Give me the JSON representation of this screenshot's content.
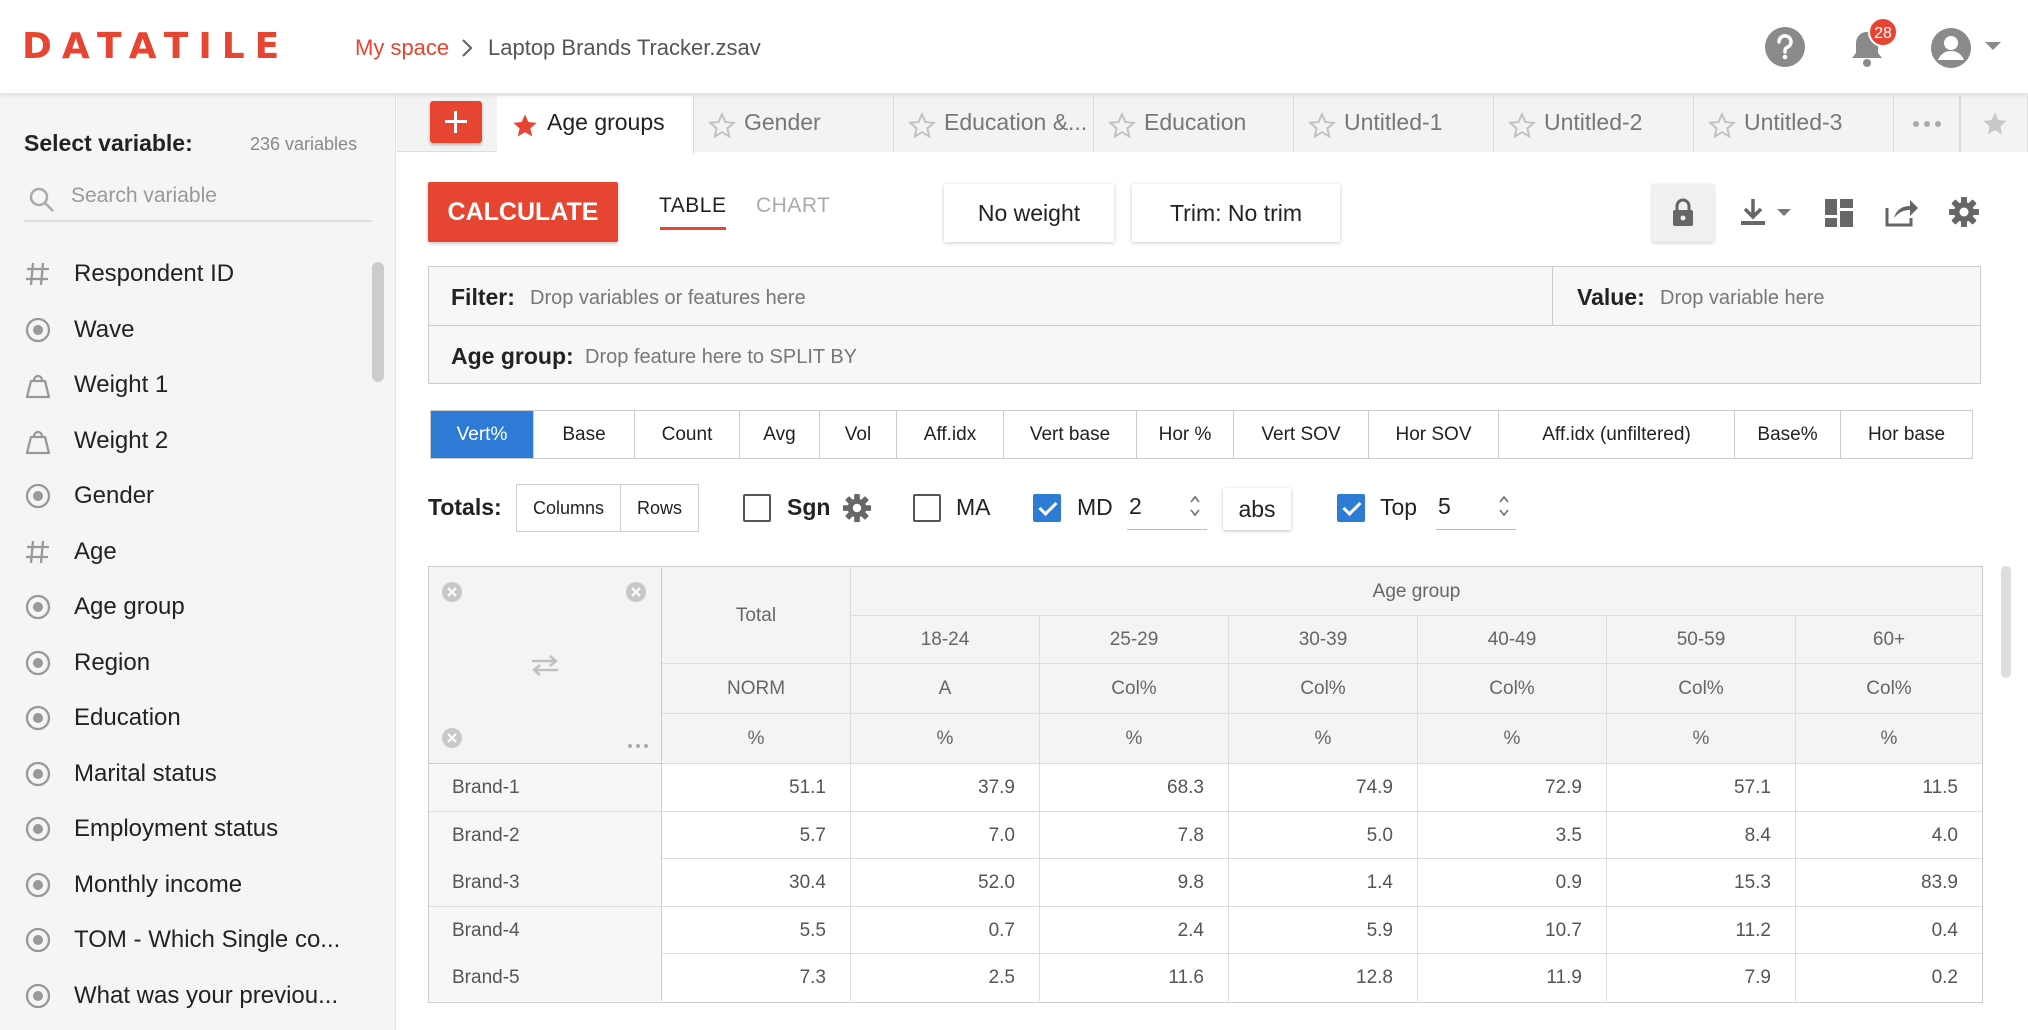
{
  "brand": {
    "logo": "DATATILE",
    "accent": "#e64532"
  },
  "header": {
    "breadcrumb_link": "My space",
    "breadcrumb_file": "Laptop Brands Tracker.zsav",
    "notification_count": "28",
    "icons": [
      "help-icon",
      "bell-icon",
      "user-icon",
      "chevron-down-icon"
    ]
  },
  "sidebar": {
    "title": "Select variable:",
    "count": "236 variables",
    "search_placeholder": "Search variable",
    "items": [
      {
        "label": "Respondent ID",
        "icon": "hash-icon"
      },
      {
        "label": "Wave",
        "icon": "radio-icon"
      },
      {
        "label": "Weight 1",
        "icon": "weight-icon"
      },
      {
        "label": "Weight 2",
        "icon": "weight-icon"
      },
      {
        "label": "Gender",
        "icon": "radio-icon"
      },
      {
        "label": "Age",
        "icon": "hash-icon"
      },
      {
        "label": "Age group",
        "icon": "radio-icon"
      },
      {
        "label": "Region",
        "icon": "radio-icon"
      },
      {
        "label": "Education",
        "icon": "radio-icon"
      },
      {
        "label": "Marital status",
        "icon": "radio-icon"
      },
      {
        "label": "Employment status",
        "icon": "radio-icon"
      },
      {
        "label": "Monthly income",
        "icon": "radio-icon"
      },
      {
        "label": "TOM - Which Single co...",
        "icon": "radio-icon"
      },
      {
        "label": "What was your previou...",
        "icon": "radio-icon"
      }
    ]
  },
  "tabs": [
    {
      "label": "Age groups",
      "starred": true,
      "active": true
    },
    {
      "label": "Gender",
      "starred": false
    },
    {
      "label": "Education &...",
      "starred": false
    },
    {
      "label": "Education",
      "starred": false
    },
    {
      "label": "Untitled-1",
      "starred": false
    },
    {
      "label": "Untitled-2",
      "starred": false
    },
    {
      "label": "Untitled-3",
      "starred": false
    }
  ],
  "toolbar": {
    "calculate": "CALCULATE",
    "view_table": "TABLE",
    "view_chart": "CHART",
    "weight": "No weight",
    "trim": "Trim: No trim"
  },
  "filter": {
    "filter_label": "Filter:",
    "filter_hint": "Drop variables or features here",
    "value_label": "Value:",
    "value_hint": "Drop variable here",
    "split_label": "Age group:",
    "split_hint": "Drop feature here to SPLIT BY"
  },
  "modes": [
    "Vert%",
    "Base",
    "Count",
    "Avg",
    "Vol",
    "Aff.idx",
    "Vert base",
    "Hor %",
    "Vert SOV",
    "Hor SOV",
    "Aff.idx (unfiltered)",
    "Base%",
    "Hor base"
  ],
  "selected_mode": "Vert%",
  "options": {
    "totals_label": "Totals:",
    "totals_columns": "Columns",
    "totals_rows": "Rows",
    "sgn_label": "Sgn",
    "sgn_checked": false,
    "ma_label": "MA",
    "ma_checked": false,
    "md_label": "MD",
    "md_checked": true,
    "md_value": "2",
    "abs_label": "abs",
    "top_label": "Top",
    "top_checked": true,
    "top_value": "5"
  },
  "table": {
    "group_header": "Age group",
    "total_header": "Total",
    "total_sub": "NORM",
    "total_unit": "%",
    "columns": [
      {
        "label": "18-24",
        "sub": "A",
        "unit": "%"
      },
      {
        "label": "25-29",
        "sub": "Col%",
        "unit": "%"
      },
      {
        "label": "30-39",
        "sub": "Col%",
        "unit": "%"
      },
      {
        "label": "40-49",
        "sub": "Col%",
        "unit": "%"
      },
      {
        "label": "50-59",
        "sub": "Col%",
        "unit": "%"
      },
      {
        "label": "60+",
        "sub": "Col%",
        "unit": "%"
      }
    ],
    "rows": [
      {
        "label": "Brand-1",
        "values": [
          "51.1",
          "37.9",
          "68.3",
          "74.9",
          "72.9",
          "57.1",
          "11.5"
        ]
      },
      {
        "label": "Brand-2",
        "values": [
          "5.7",
          "7.0",
          "7.8",
          "5.0",
          "3.5",
          "8.4",
          "4.0"
        ]
      },
      {
        "label": "Brand-3",
        "values": [
          "30.4",
          "52.0",
          "9.8",
          "1.4",
          "0.9",
          "15.3",
          "83.9"
        ]
      },
      {
        "label": "Brand-4",
        "values": [
          "5.5",
          "0.7",
          "2.4",
          "5.9",
          "10.7",
          "11.2",
          "0.4"
        ]
      },
      {
        "label": "Brand-5",
        "values": [
          "7.3",
          "2.5",
          "11.6",
          "12.8",
          "11.9",
          "7.9",
          "0.2"
        ]
      }
    ]
  }
}
